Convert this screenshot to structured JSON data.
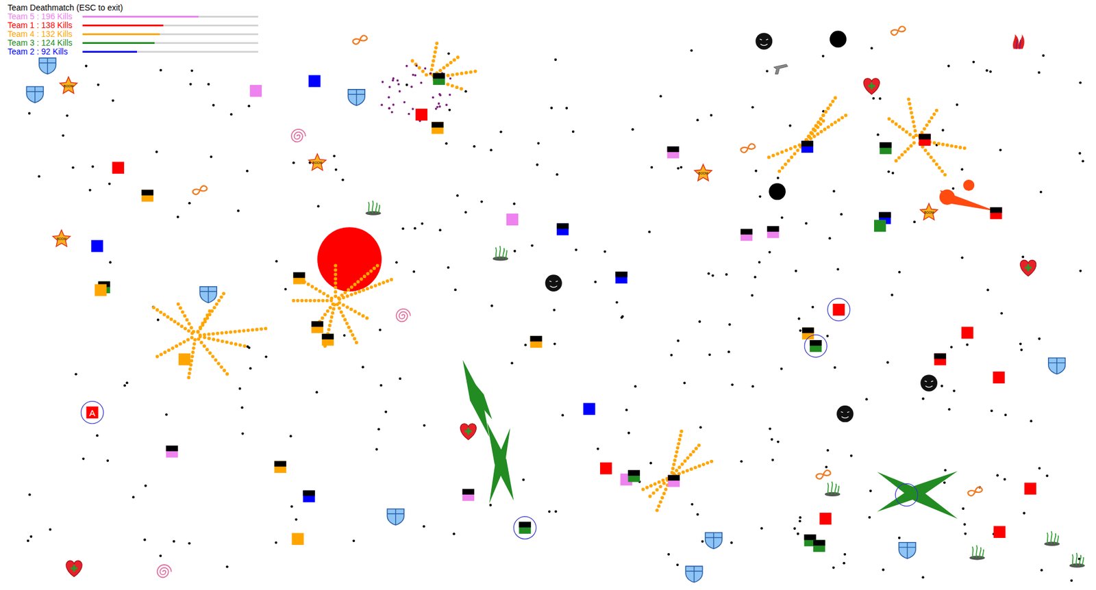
{
  "title": "Team Deathmatch (ESC to exit)",
  "teams": [
    {
      "label": "Team 5 : 196 Kills",
      "level": 0.66,
      "color": "#ee82ee"
    },
    {
      "label": "Team 1 : 138 Kills",
      "level": 0.46,
      "color": "#ff0000"
    },
    {
      "label": "Team 4 : 132 Kills",
      "level": 0.44,
      "color": "#ffa500"
    },
    {
      "label": "Team 3 : 124 Kills",
      "level": 0.41,
      "color": "#228b22"
    },
    {
      "label": "Team 2 : 92 Kills",
      "level": 0.31,
      "color": "#0000ff"
    }
  ],
  "star_label": "BOOM",
  "players": [
    {
      "color": "#0000ff",
      "damaged": false,
      "shielded": false
    },
    {
      "color": "#ee82ee",
      "damaged": false,
      "shielded": false
    },
    {
      "color": "#228b22",
      "damaged": true,
      "shielded": false
    },
    {
      "color": "#ff0000",
      "damaged": false,
      "shielded": false
    },
    {
      "color": "#ffa500",
      "damaged": true,
      "shielded": false
    },
    {
      "color": "#ff0000",
      "damaged": false,
      "shielded": false
    },
    {
      "color": "#ffa500",
      "damaged": true,
      "shielded": false
    },
    {
      "color": "#ee82ee",
      "damaged": false,
      "shielded": false
    },
    {
      "color": "#0000ff",
      "damaged": true,
      "shielded": false
    },
    {
      "color": "#0000ff",
      "damaged": false,
      "shielded": false
    },
    {
      "color": "#228b22",
      "damaged": true,
      "shielded": false
    },
    {
      "color": "#ffa500",
      "damaged": false,
      "shielded": false
    },
    {
      "color": "#ffa500",
      "damaged": true,
      "shielded": false
    },
    {
      "color": "#ffa500",
      "damaged": true,
      "shielded": false
    },
    {
      "color": "#ffa500",
      "damaged": true,
      "shielded": false
    },
    {
      "color": "#ffa500",
      "damaged": false,
      "shielded": false
    },
    {
      "color": "#0000ff",
      "damaged": true,
      "shielded": false
    },
    {
      "color": "#ffa500",
      "damaged": true,
      "shielded": false
    },
    {
      "color": "#ee82ee",
      "damaged": true,
      "shielded": false
    },
    {
      "color": "#ee82ee",
      "damaged": true,
      "shielded": false
    },
    {
      "color": "#ee82ee",
      "damaged": true,
      "shielded": false
    },
    {
      "color": "#0000ff",
      "damaged": true,
      "shielded": false
    },
    {
      "color": "#228b22",
      "damaged": true,
      "shielded": false
    },
    {
      "color": "#ff0000",
      "damaged": true,
      "shielded": false
    },
    {
      "color": "#0000ff",
      "damaged": true,
      "shielded": false
    },
    {
      "color": "#228b22",
      "damaged": false,
      "shielded": false
    },
    {
      "color": "#ff0000",
      "damaged": true,
      "shielded": false
    },
    {
      "color": "#ff0000",
      "damaged": false,
      "shielded": true
    },
    {
      "color": "#ffa500",
      "damaged": true,
      "shielded": false
    },
    {
      "color": "#228b22",
      "damaged": true,
      "shielded": true
    },
    {
      "color": "#ff0000",
      "damaged": false,
      "shielded": false
    },
    {
      "color": "#ff0000",
      "damaged": true,
      "shielded": false
    },
    {
      "color": "#ff0000",
      "damaged": false,
      "shielded": false
    },
    {
      "color": "#0000ff",
      "damaged": false,
      "shielded": false
    },
    {
      "color": "#ff0000",
      "damaged": false,
      "shielded": true,
      "label": "A"
    },
    {
      "color": "#ee82ee",
      "damaged": true,
      "shielded": false
    },
    {
      "color": "#ffa500",
      "damaged": true,
      "shielded": false
    },
    {
      "color": "#0000ff",
      "damaged": true,
      "shielded": false
    },
    {
      "color": "#ffa500",
      "damaged": false,
      "shielded": false
    },
    {
      "color": "#ee82ee",
      "damaged": true,
      "shielded": false
    },
    {
      "color": "#228b22",
      "damaged": true,
      "shielded": true
    },
    {
      "color": "#ff0000",
      "damaged": false,
      "shielded": false
    },
    {
      "color": "#ee82ee",
      "damaged": false,
      "shielded": false
    },
    {
      "color": "#228b22",
      "damaged": true,
      "shielded": false
    },
    {
      "color": "#ee82ee",
      "damaged": true,
      "shielded": false
    },
    {
      "color": "#ff0000",
      "damaged": false,
      "shielded": false
    },
    {
      "color": "#ff0000",
      "damaged": false,
      "shielded": false
    },
    {
      "color": "#ff0000",
      "damaged": false,
      "shielded": false
    },
    {
      "color": "#228b22",
      "damaged": true,
      "shielded": false
    },
    {
      "color": "#228b22",
      "damaged": true,
      "shielded": false
    }
  ]
}
